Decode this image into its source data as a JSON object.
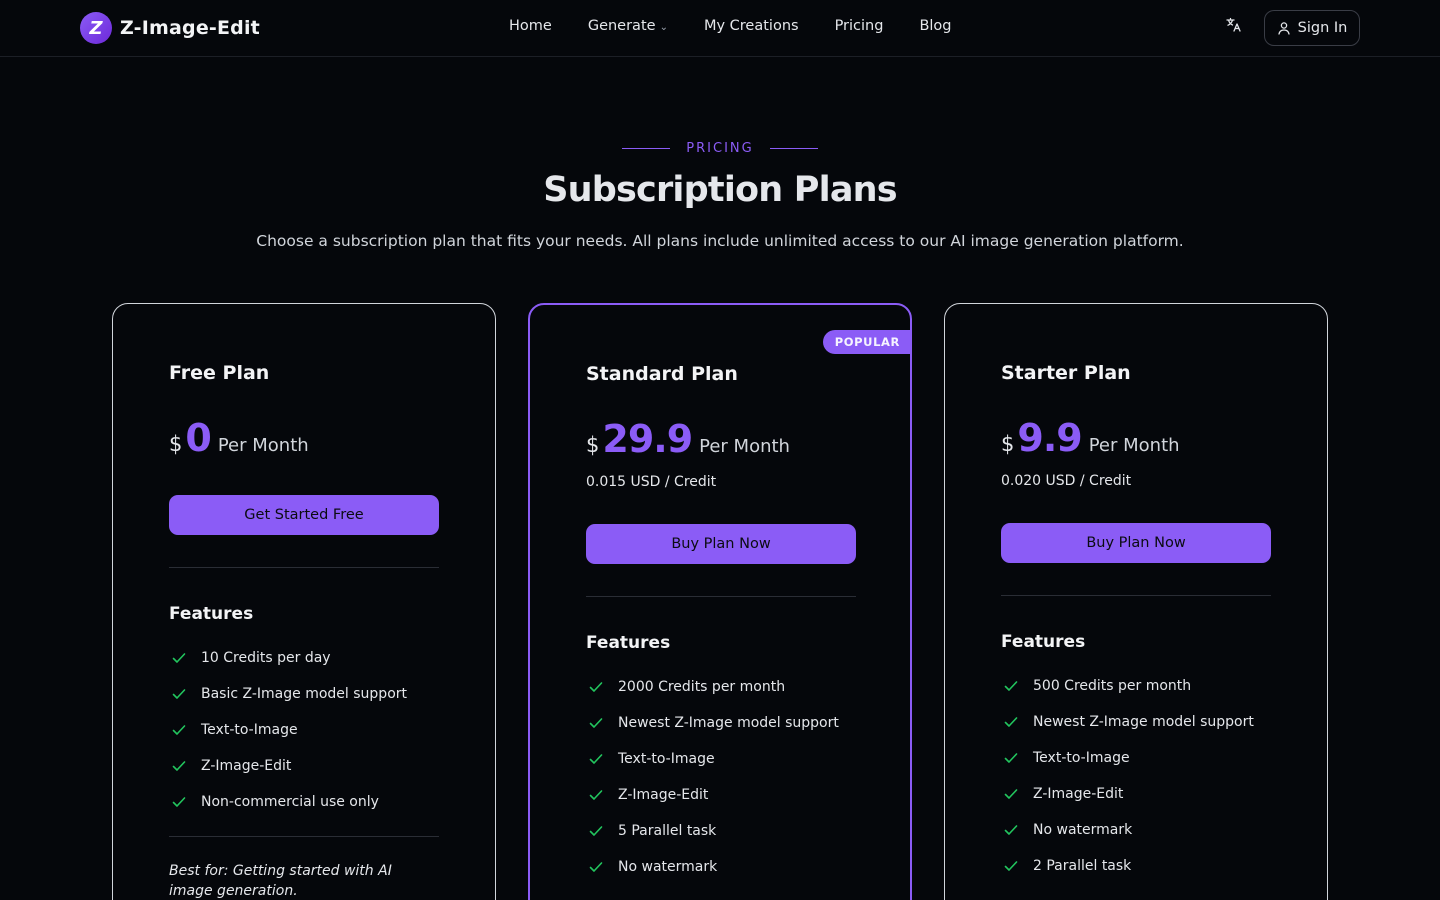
{
  "header": {
    "brand": "Z-Image-Edit",
    "logo_letter": "Z",
    "nav": [
      {
        "label": "Home"
      },
      {
        "label": "Generate"
      },
      {
        "label": "My Creations"
      },
      {
        "label": "Pricing"
      },
      {
        "label": "Blog"
      }
    ],
    "translate_icon": "translate-icon",
    "signin_label": "Sign In"
  },
  "section": {
    "eyebrow": "PRICING",
    "title": "Subscription Plans",
    "subtitle": "Choose a subscription plan that fits your needs. All plans include unlimited access to our AI image generation platform."
  },
  "colors": {
    "accent": "#8b5cf6",
    "check": "#22c55e",
    "background": "#05070b"
  },
  "plans": [
    {
      "name": "Free Plan",
      "currency": "$",
      "amount": "0",
      "period": "Per Month",
      "button": "Get Started Free",
      "features_heading": "Features",
      "features": [
        "10 Credits per day",
        "Basic Z-Image model support",
        "Text-to-Image",
        "Z-Image-Edit",
        "Non-commercial use only"
      ],
      "best_for": "Best for: Getting started with AI image generation."
    },
    {
      "name": "Standard Plan",
      "badge": "POPULAR",
      "currency": "$",
      "amount": "29.9",
      "period": "Per Month",
      "credit": "0.015 USD / Credit",
      "button": "Buy Plan Now",
      "features_heading": "Features",
      "features": [
        "2000 Credits per month",
        "Newest Z-Image model support",
        "Text-to-Image",
        "Z-Image-Edit",
        "5 Parallel task",
        "No watermark"
      ]
    },
    {
      "name": "Starter Plan",
      "currency": "$",
      "amount": "9.9",
      "period": "Per Month",
      "credit": "0.020 USD / Credit",
      "button": "Buy Plan Now",
      "features_heading": "Features",
      "features": [
        "500 Credits per month",
        "Newest Z-Image model support",
        "Text-to-Image",
        "Z-Image-Edit",
        "No watermark",
        "2 Parallel task"
      ]
    }
  ]
}
